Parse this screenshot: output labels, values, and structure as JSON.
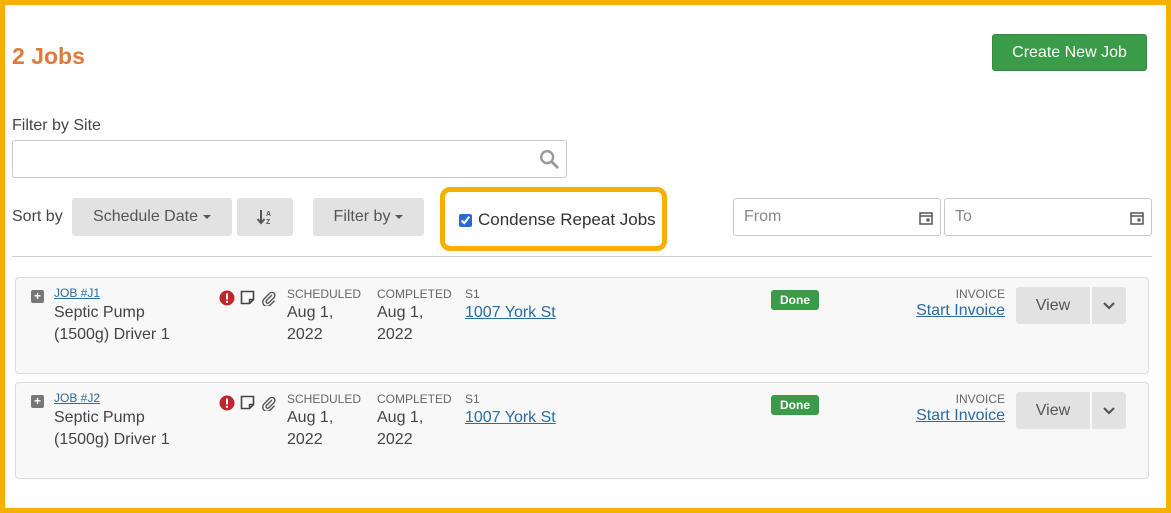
{
  "header": {
    "title": "2 Jobs",
    "create_label": "Create New Job"
  },
  "filter": {
    "site_label": "Filter by Site",
    "site_value": "",
    "site_placeholder": ""
  },
  "toolbar": {
    "sort_label": "Sort by",
    "sort_value": "Schedule Date",
    "filter_by_label": "Filter by",
    "condense_label": "Condense Repeat Jobs",
    "condense_checked": true,
    "from_placeholder": "From",
    "to_placeholder": "To"
  },
  "icons": {
    "search": "search-icon",
    "sort_direction": "sort-direction-icon",
    "calendar": "calendar-icon",
    "expand": "expand-icon",
    "alert": "alert-icon",
    "note": "note-icon",
    "attachment": "paperclip-icon",
    "chevron": "chevron-down-icon"
  },
  "colors": {
    "accent_orange": "#e07a3a",
    "primary_green": "#3a9b48",
    "highlight": "#f5b100",
    "link": "#2b6ca3",
    "alert_red": "#c0272d"
  },
  "jobs": [
    {
      "number": "JOB #J1",
      "name": "Septic Pump (1500g) Driver 1",
      "scheduled_label": "SCHEDULED",
      "scheduled": "Aug 1, 2022",
      "completed_label": "COMPLETED",
      "completed": "Aug 1, 2022",
      "site_label": "S1",
      "address": "1007 York St",
      "status": "Done",
      "invoice_label": "INVOICE",
      "invoice_action": "Start Invoice",
      "view_label": "View"
    },
    {
      "number": "JOB #J2",
      "name": "Septic Pump (1500g) Driver 1",
      "scheduled_label": "SCHEDULED",
      "scheduled": "Aug 1, 2022",
      "completed_label": "COMPLETED",
      "completed": "Aug 1, 2022",
      "site_label": "S1",
      "address": "1007 York St",
      "status": "Done",
      "invoice_label": "INVOICE",
      "invoice_action": "Start Invoice",
      "view_label": "View"
    }
  ]
}
